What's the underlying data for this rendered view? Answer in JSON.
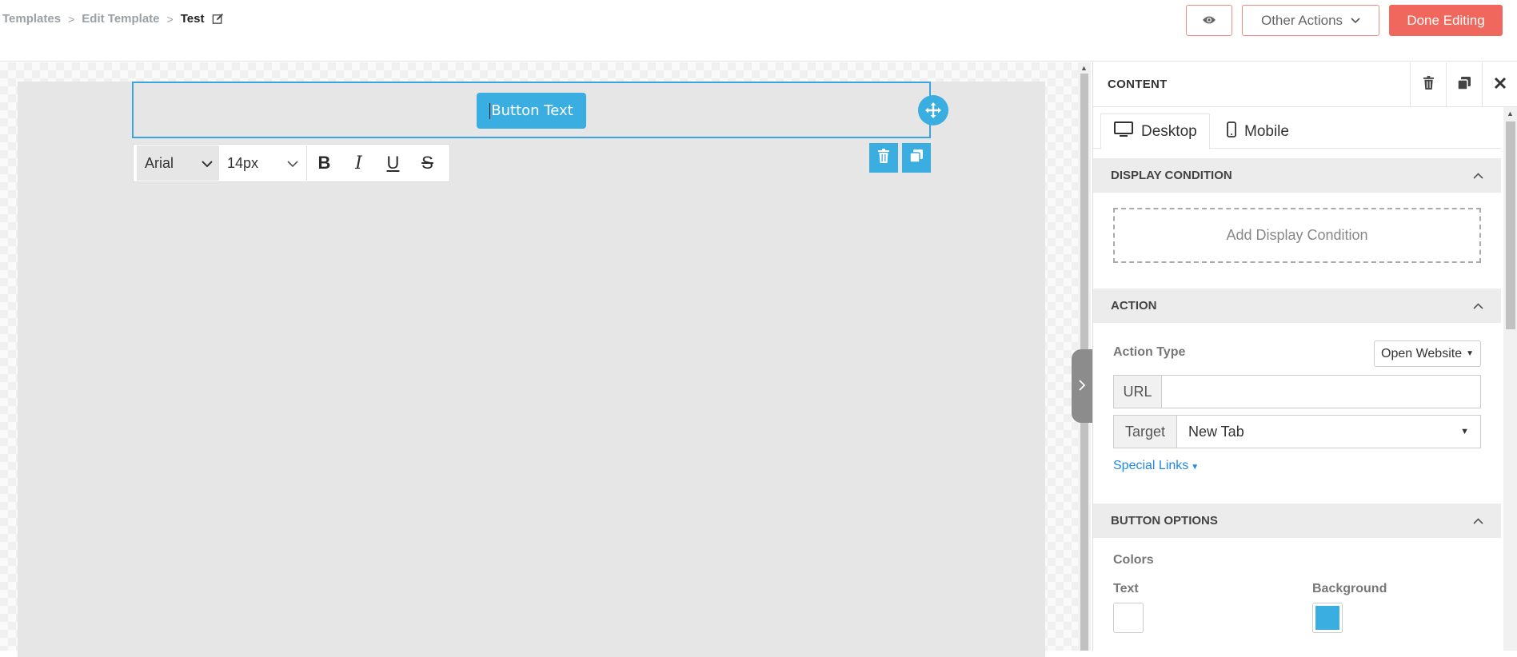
{
  "breadcrumb": {
    "item1": "Templates",
    "sep1": ">",
    "item2": "Edit Template",
    "sep2": ">",
    "current": "Test"
  },
  "header": {
    "other_actions": "Other Actions",
    "done_editing": "Done Editing"
  },
  "canvas": {
    "button_text": "Button Text"
  },
  "toolbar": {
    "font": "Arial",
    "size": "14px",
    "bold": "B",
    "italic": "I",
    "underline": "U",
    "strike": "S"
  },
  "panel": {
    "title": "CONTENT",
    "tabs": {
      "desktop": "Desktop",
      "mobile": "Mobile"
    },
    "display_condition": {
      "heading": "DISPLAY CONDITION",
      "add": "Add Display Condition"
    },
    "action": {
      "heading": "ACTION",
      "type_label": "Action Type",
      "type_value": "Open Website",
      "url_label": "URL",
      "url_value": "",
      "target_label": "Target",
      "target_value": "New Tab",
      "special_links": "Special Links"
    },
    "button_options": {
      "heading": "BUTTON OPTIONS",
      "colors_label": "Colors",
      "text_label": "Text",
      "background_label": "Background",
      "text_color": "#ffffff",
      "background_color": "#3aaee1"
    }
  },
  "colors": {
    "accent": "#3aaee1",
    "done_button": "#f0675d",
    "header_border": "#f08c7e"
  }
}
